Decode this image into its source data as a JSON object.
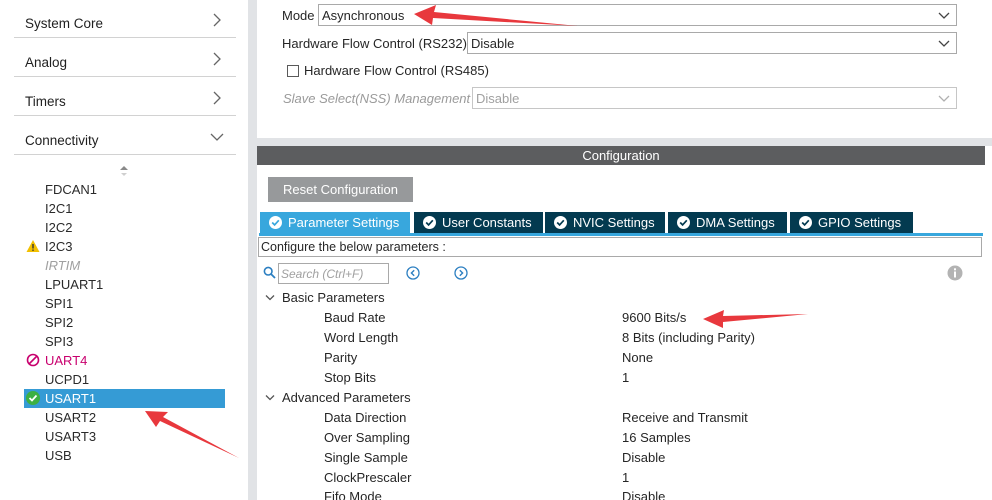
{
  "sidebar": {
    "categories": [
      {
        "label": "System Core",
        "expanded": false
      },
      {
        "label": "Analog",
        "expanded": false
      },
      {
        "label": "Timers",
        "expanded": false
      },
      {
        "label": "Connectivity",
        "expanded": true
      }
    ],
    "peripherals": [
      {
        "label": "FDCAN1",
        "status": "none"
      },
      {
        "label": "I2C1",
        "status": "none"
      },
      {
        "label": "I2C2",
        "status": "none"
      },
      {
        "label": "I2C3",
        "status": "warning"
      },
      {
        "label": "IRTIM",
        "status": "disabled"
      },
      {
        "label": "LPUART1",
        "status": "none"
      },
      {
        "label": "SPI1",
        "status": "none"
      },
      {
        "label": "SPI2",
        "status": "none"
      },
      {
        "label": "SPI3",
        "status": "none"
      },
      {
        "label": "UART4",
        "status": "error"
      },
      {
        "label": "UCPD1",
        "status": "none"
      },
      {
        "label": "USART1",
        "status": "ok",
        "selected": true
      },
      {
        "label": "USART2",
        "status": "none"
      },
      {
        "label": "USART3",
        "status": "none"
      },
      {
        "label": "USB",
        "status": "none"
      }
    ]
  },
  "mode": {
    "mode_label": "Mode",
    "mode_value": "Asynchronous",
    "hw_flow_232_label": "Hardware Flow Control (RS232)",
    "hw_flow_232_value": "Disable",
    "hw_flow_485_label": "Hardware Flow Control (RS485)",
    "hw_flow_485_checked": false,
    "nss_label": "Slave Select(NSS) Management",
    "nss_value": "Disable"
  },
  "configuration": {
    "header": "Configuration",
    "reset_label": "Reset Configuration",
    "tabs": [
      {
        "label": "Parameter Settings",
        "active": true
      },
      {
        "label": "User Constants",
        "active": false
      },
      {
        "label": "NVIC Settings",
        "active": false
      },
      {
        "label": "DMA Settings",
        "active": false
      },
      {
        "label": "GPIO Settings",
        "active": false
      }
    ],
    "banner": "Configure the below parameters :",
    "search_placeholder": "Search (Ctrl+F)",
    "groups": [
      {
        "label": "Basic Parameters",
        "params": [
          {
            "name": "Baud Rate",
            "value": "9600 Bits/s"
          },
          {
            "name": "Word Length",
            "value": "8 Bits (including Parity)"
          },
          {
            "name": "Parity",
            "value": "None"
          },
          {
            "name": "Stop Bits",
            "value": "1"
          }
        ]
      },
      {
        "label": "Advanced Parameters",
        "params": [
          {
            "name": "Data Direction",
            "value": "Receive and Transmit"
          },
          {
            "name": "Over Sampling",
            "value": "16 Samples"
          },
          {
            "name": "Single Sample",
            "value": "Disable"
          },
          {
            "name": "ClockPrescaler",
            "value": "1"
          },
          {
            "name": "Fifo Mode",
            "value": "Disable"
          }
        ]
      }
    ]
  },
  "colors": {
    "selected_blue": "#359bd5",
    "active_tab": "#38a7dd",
    "inactive_tab": "#033a50",
    "header_grey": "#5c5d5f",
    "annotation_red": "#e8383d",
    "ok_green": "#3cb043",
    "warning_yellow": "#f2c000",
    "error_magenta": "#c8006e"
  }
}
